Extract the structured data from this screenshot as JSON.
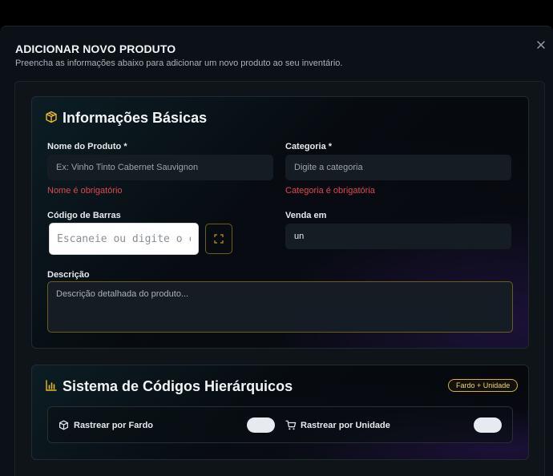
{
  "modal": {
    "title": "ADICIONAR NOVO PRODUTO",
    "subtitle": "Preencha as informações abaixo para adicionar um novo produto ao seu inventário.",
    "close_icon": "close-icon"
  },
  "basic": {
    "title": "Informações Básicas",
    "icon": "package-icon",
    "accent_color": "#e8b923",
    "product_name": {
      "label": "Nome do Produto *",
      "placeholder": "Ex: Vinho Tinto Cabernet Sauvignon",
      "value": "",
      "error": "Nome é obrigatório"
    },
    "category": {
      "label": "Categoria *",
      "placeholder": "Digite a categoria",
      "value": "",
      "error": "Categoria é obrigatória"
    },
    "barcode": {
      "label": "Código de Barras",
      "placeholder": "Escaneie ou digite o código",
      "value": "",
      "scan_icon": "scan-icon"
    },
    "sold_in": {
      "label": "Venda em",
      "value": "un"
    },
    "description": {
      "label": "Descrição",
      "placeholder": "Descrição detalhada do produto...",
      "value": ""
    }
  },
  "hierarchy": {
    "title": "Sistema de Códigos Hierárquicos",
    "icon": "bar-chart-icon",
    "badge": "Fardo + Unidade",
    "track_bundle": {
      "label": "Rastrear por Fardo",
      "icon": "box-icon",
      "enabled": false
    },
    "track_unit": {
      "label": "Rastrear por Unidade",
      "icon": "cart-icon",
      "enabled": false
    }
  },
  "colors": {
    "error": "#e0474c",
    "accent": "#e8b923",
    "surface": "#0c1117"
  }
}
